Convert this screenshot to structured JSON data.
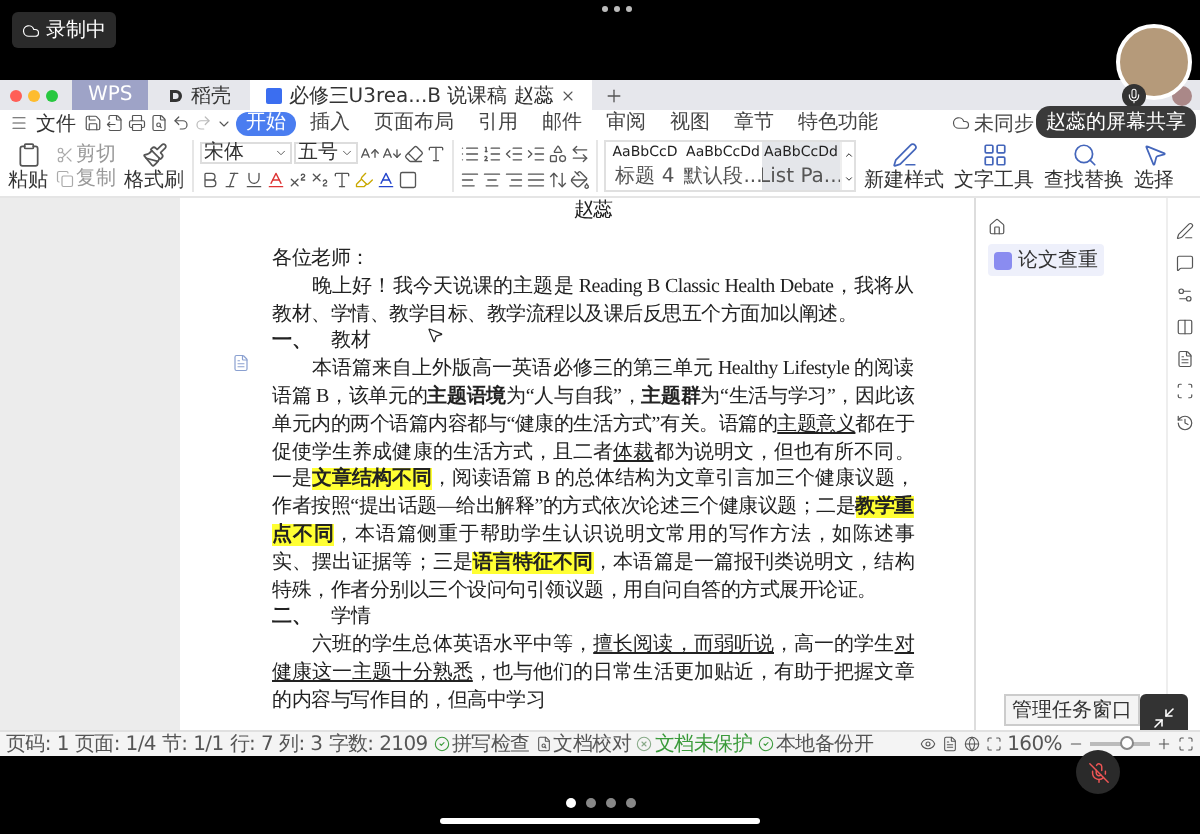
{
  "screen_share": {
    "recording_label": "录制中",
    "sharer_tooltip": "赵蕊的屏幕共享",
    "mic_muted": true
  },
  "window": {
    "tabs": [
      {
        "label": "WPS",
        "kind": "home",
        "selected": false
      },
      {
        "label": "稻壳",
        "kind": "docer",
        "selected": false
      },
      {
        "label": "必修三U3rea...B 说课稿 赵蕊",
        "kind": "doc",
        "selected": true
      }
    ],
    "file_label": "文件",
    "menu": [
      {
        "label": "开始",
        "selected": true
      },
      {
        "label": "插入",
        "selected": false
      },
      {
        "label": "页面布局",
        "selected": false
      },
      {
        "label": "引用",
        "selected": false
      },
      {
        "label": "邮件",
        "selected": false
      },
      {
        "label": "审阅",
        "selected": false
      },
      {
        "label": "视图",
        "selected": false
      },
      {
        "label": "章节",
        "selected": false
      },
      {
        "label": "特色功能",
        "selected": false
      }
    ],
    "sync_label": "未同步"
  },
  "ribbon": {
    "paste_label": "粘贴",
    "cut_label": "剪切",
    "copy_label": "复制",
    "format_painter_label": "格式刷",
    "font_name": "宋体",
    "font_size": "五号",
    "styles": [
      {
        "preview": "AaBbCcD",
        "label": "标题 4",
        "selected": false
      },
      {
        "preview": "AaBbCcDd",
        "label": "默认段...",
        "selected": false
      },
      {
        "preview": "AaBbCcDd",
        "label": "List Pa...",
        "selected": true
      }
    ],
    "tools": [
      {
        "label": "新建样式",
        "kind": "style"
      },
      {
        "label": "文字工具",
        "kind": "text"
      },
      {
        "label": "查找替换",
        "kind": "find"
      },
      {
        "label": "选择",
        "kind": "select"
      }
    ]
  },
  "document": {
    "title": "赵蕊",
    "paragraphs": [
      {
        "kind": "salutation",
        "segments": [
          {
            "text": "各位老师：",
            "kind": "plain"
          }
        ]
      },
      {
        "kind": "body",
        "segments": [
          {
            "text": "晚上好！我今天说课的主题是 Reading B Classic Health Debate，我将从教材、学情、教学目标、教学流程以及课后反思五个方面加以阐述。",
            "kind": "plain"
          }
        ]
      },
      {
        "kind": "heading",
        "number": "一、",
        "segments": [
          {
            "text": "教材",
            "kind": "plain"
          }
        ]
      },
      {
        "kind": "body",
        "segments": [
          {
            "text": "本语篇来自上外版高一英语必修三的第三单元 Healthy Lifestyle 的阅读语篇 B，该单元的",
            "kind": "plain"
          },
          {
            "text": "主题语境",
            "kind": "bold"
          },
          {
            "text": "为“人与自我”，",
            "kind": "plain"
          },
          {
            "text": "主题群",
            "kind": "bold"
          },
          {
            "text": "为“生活与学习”，因此该单元内的两个语篇内容都与“健康的生活方式”有关。语篇的",
            "kind": "plain"
          },
          {
            "text": "主题意义",
            "kind": "underline"
          },
          {
            "text": "都在于促使学生养成健康的生活方式，且二者",
            "kind": "plain"
          },
          {
            "text": "体裁",
            "kind": "underline"
          },
          {
            "text": "都为说明文，但也有所不同。一是",
            "kind": "plain"
          },
          {
            "text": "文章结构不同",
            "kind": "highlight"
          },
          {
            "text": "，阅读语篇 B 的总体结构为文章引言加三个健康议题，作者按照“提出话题—给出解释”的方式依次论述三个健康议题；二是",
            "kind": "plain"
          },
          {
            "text": "教学重点不同",
            "kind": "highlight"
          },
          {
            "text": "，本语篇侧重于帮助学生认识说明文常用的写作方法，如陈述事实、摆出证据等；三是",
            "kind": "plain"
          },
          {
            "text": "语言特征不同",
            "kind": "highlight"
          },
          {
            "text": "，本语篇是一篇报刊类说明文，结构特殊，作者分别以三个设问句引领议题，用自问自答的方式展开论证。",
            "kind": "plain"
          }
        ]
      },
      {
        "kind": "heading",
        "number": "二、",
        "segments": [
          {
            "text": "学情",
            "kind": "plain"
          }
        ]
      },
      {
        "kind": "body",
        "segments": [
          {
            "text": "六班的学生总体英语水平中等，",
            "kind": "plain"
          },
          {
            "text": "擅长阅读，而弱听说",
            "kind": "underline"
          },
          {
            "text": "，高一的学生",
            "kind": "plain"
          },
          {
            "text": "对健康这一主题十分熟悉",
            "kind": "underline"
          },
          {
            "text": "，也与他们的日常生活更加贴近，有助于把握文章的内容与写作目的，但高中学习",
            "kind": "plain"
          }
        ]
      }
    ]
  },
  "side_panel": {
    "check_button": "论文查重"
  },
  "task_tooltip": "管理任务窗口",
  "status_bar": {
    "items": [
      {
        "text": "页码: 1",
        "kind": "plain"
      },
      {
        "text": "页面: 1/4",
        "kind": "plain"
      },
      {
        "text": "节: 1/1",
        "kind": "plain"
      },
      {
        "text": "行: 7",
        "kind": "plain"
      },
      {
        "text": "列: 3",
        "kind": "plain"
      },
      {
        "text": "字数: 2109",
        "kind": "plain"
      },
      {
        "text": "拼写检查",
        "kind": "check"
      },
      {
        "text": "文档校对",
        "kind": "proof"
      },
      {
        "text": "文档未保护",
        "kind": "unprotected"
      },
      {
        "text": "本地备份开",
        "kind": "check"
      }
    ],
    "zoom": "160%",
    "zoom_slider": {
      "level": 0.6
    }
  },
  "pager": {
    "dots": [
      {
        "selected": true
      },
      {
        "selected": false
      },
      {
        "selected": false
      },
      {
        "selected": false
      }
    ]
  }
}
